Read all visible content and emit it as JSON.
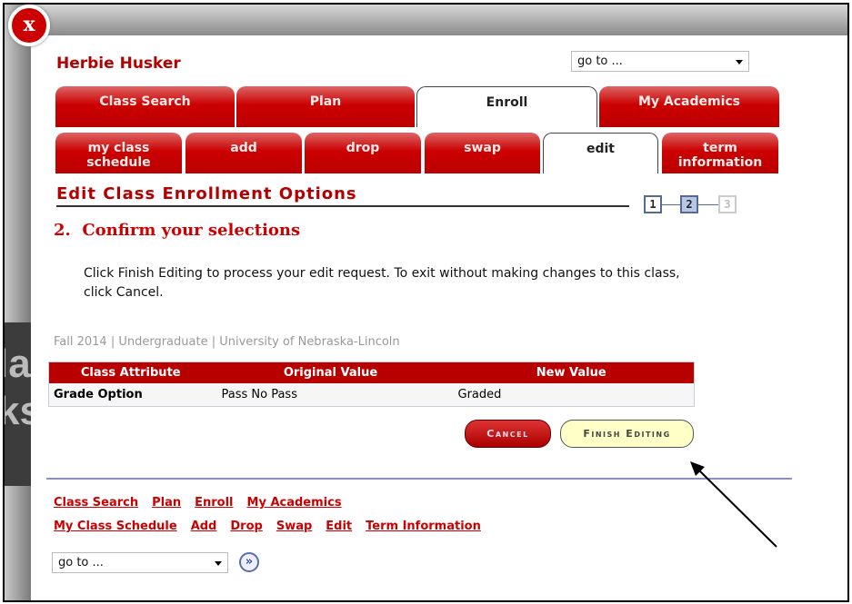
{
  "header": {
    "user_name": "Herbie Husker",
    "goto_select": "go to ...",
    "close_label": "X"
  },
  "main_tabs": [
    {
      "label": "Class Search"
    },
    {
      "label": "Plan"
    },
    {
      "label": "Enroll",
      "active": true
    },
    {
      "label": "My Academics"
    }
  ],
  "sub_tabs": [
    {
      "label": "my class schedule"
    },
    {
      "label": "add"
    },
    {
      "label": "drop"
    },
    {
      "label": "swap"
    },
    {
      "label": "edit",
      "active": true
    },
    {
      "label": "term information"
    }
  ],
  "page": {
    "title": "Edit Class Enrollment Options",
    "steps": [
      "1",
      "2",
      "3"
    ],
    "current_step": 2,
    "step_heading": "2.  Confirm your selections",
    "instructions": "Click Finish Editing to process your edit request.  To exit without making changes to this class, click Cancel.",
    "term_line": "Fall 2014 | Undergraduate | University of Nebraska-Lincoln"
  },
  "table": {
    "headers": [
      "Class Attribute",
      "Original Value",
      "New Value"
    ],
    "rows": [
      [
        "Grade Option",
        "Pass No Pass",
        "Graded"
      ]
    ]
  },
  "buttons": {
    "cancel": "Cancel",
    "finish": "Finish Editing"
  },
  "footer": {
    "links_row1": [
      "Class Search",
      "Plan",
      "Enroll",
      "My Academics"
    ],
    "links_row2": [
      "My Class Schedule",
      "Add",
      "Drop",
      "Swap",
      "Edit",
      "Term Information"
    ],
    "goto_select": "go to ...",
    "go_icon": "double-chevron-right-icon"
  },
  "background_text": [
    "la",
    "ks"
  ],
  "colors": {
    "brand_red": "#c00000",
    "finish_button": "#ffffc8"
  }
}
